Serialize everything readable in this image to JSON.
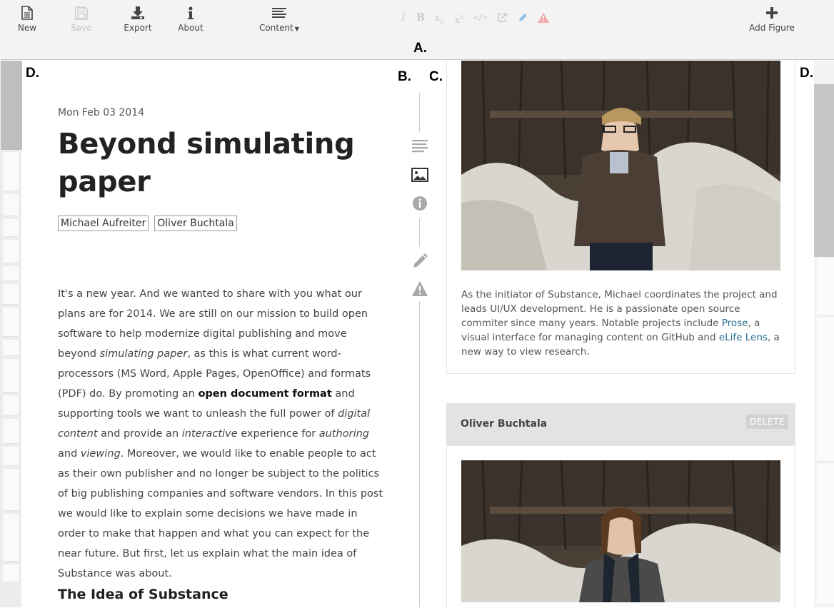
{
  "toolbar": {
    "new_label": "New",
    "save_label": "Save",
    "export_label": "Export",
    "about_label": "About",
    "content_label": "Content",
    "add_figure_label": "Add Figure",
    "format_icons": [
      "italic-icon",
      "bold-icon",
      "subscript-icon",
      "superscript-icon",
      "code-icon",
      "link-icon",
      "pencil-icon",
      "warning-icon"
    ]
  },
  "labels": {
    "a": "A.",
    "b": "B.",
    "c": "C.",
    "d_left": "D.",
    "d_right": "D."
  },
  "document": {
    "date": "Mon Feb 03 2014",
    "title": "Beyond simulating paper",
    "authors": [
      "Michael Aufreiter",
      "Oliver Buchtala"
    ],
    "body": {
      "p1": "It's a new year. And we wanted to share with you what our plans are for 2014. We are still on our mission to build open software to help modernize digital publishing and move beyond ",
      "em_simulating_paper": "simulating paper",
      "p2": ", as this is what current word-processors (MS Word, Apple Pages, OpenOffice) and formats (PDF) do. By promoting an ",
      "b_open_document_format": "open document format",
      "p3": " and supporting tools we want to unleash the full power of ",
      "em_digital_content": "digital content",
      "p4": " and provide an ",
      "em_interactive": "interactive",
      "p5": " experience for ",
      "em_authoring": "authoring",
      "p6": " and ",
      "em_viewing": "viewing",
      "p7": ". Moreover, we would like to enable people to act as their own publisher and no longer be subject to the politics of big publishing companies and software vendors. In this post we would like to explain some decisions we have made in order to make that happen and what you can expect for the near future. But first, let us explain what the main idea of Substance was about."
    },
    "heading": "The Idea of Substance"
  },
  "rail": {
    "icons": [
      "paragraph-icon",
      "image-icon",
      "info-icon",
      "pencil-icon",
      "warning-icon"
    ]
  },
  "figures": {
    "card1": {
      "caption_pre": "As the initiator of Substance, Michael coordinates the project and leads UI/UX development. He is a passionate open source commiter since many years. Notable projects include ",
      "link1": "Prose",
      "caption_mid": ", a visual interface for managing content on GitHub and ",
      "link2": "eLife Lens",
      "caption_post": ", a new way to view research."
    },
    "card2": {
      "name": "Oliver Buchtala",
      "delete_label": "DELETE"
    }
  },
  "colors": {
    "toolbar_bg": "#f3f3f3",
    "link": "#2a6f92",
    "card_header_bg": "#e3e3e3"
  }
}
